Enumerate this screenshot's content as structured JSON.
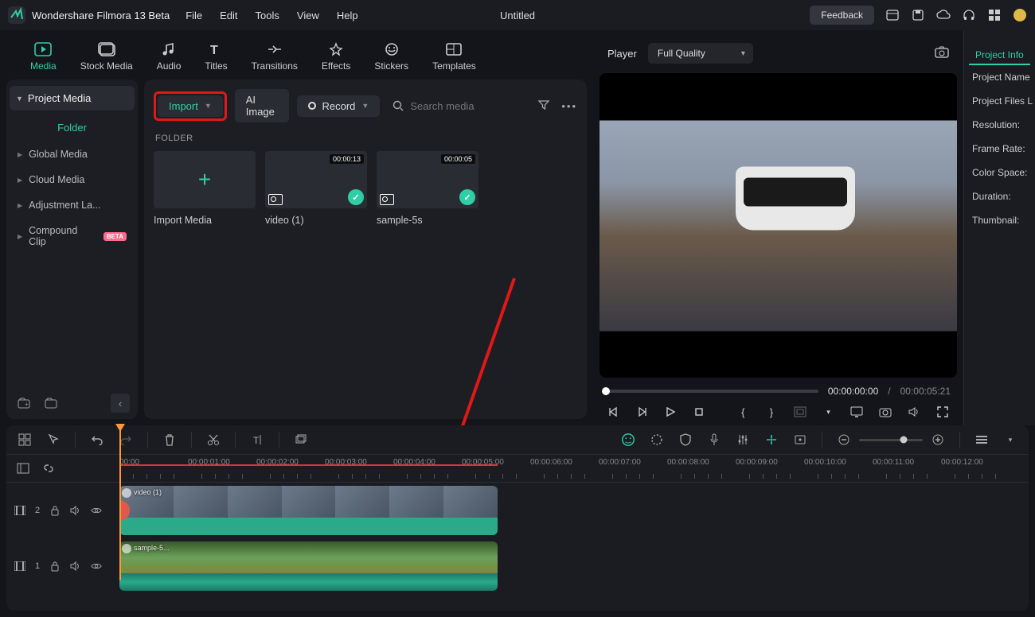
{
  "titlebar": {
    "appname": "Wondershare Filmora 13 Beta",
    "menu": [
      "File",
      "Edit",
      "Tools",
      "View",
      "Help"
    ],
    "project_title": "Untitled",
    "feedback": "Feedback"
  },
  "module_tabs": [
    {
      "label": "Media",
      "active": true
    },
    {
      "label": "Stock Media"
    },
    {
      "label": "Audio"
    },
    {
      "label": "Titles"
    },
    {
      "label": "Transitions"
    },
    {
      "label": "Effects"
    },
    {
      "label": "Stickers"
    },
    {
      "label": "Templates"
    }
  ],
  "sidebar": {
    "header": "Project Media",
    "folder_label": "Folder",
    "items": [
      {
        "label": "Global Media"
      },
      {
        "label": "Cloud Media"
      },
      {
        "label": "Adjustment La..."
      },
      {
        "label": "Compound Clip",
        "beta": true
      }
    ]
  },
  "content": {
    "import_btn": "Import",
    "ai_image_btn": "AI Image",
    "record_btn": "Record",
    "search_placeholder": "Search media",
    "folder_section": "FOLDER",
    "thumbs": [
      {
        "label": "Import Media",
        "type": "add"
      },
      {
        "label": "video (1)",
        "duration": "00:00:13",
        "scene": "vr"
      },
      {
        "label": "sample-5s",
        "duration": "00:00:05",
        "scene": "park"
      }
    ]
  },
  "preview": {
    "player_label": "Player",
    "quality": "Full Quality",
    "current_time": "00:00:00:00",
    "sep": "/",
    "total_time": "00:00:05:21"
  },
  "info_panel": {
    "tab": "Project Info",
    "fields": [
      "Project Name",
      "Project Files L",
      "Resolution:",
      "Frame Rate:",
      "Color Space:",
      "Duration:",
      "Thumbnail:"
    ]
  },
  "timeline": {
    "ruler": [
      "00:00",
      "00:00:01:00",
      "00:00:02:00",
      "00:00:03:00",
      "00:00:04:00",
      "00:00:05:00",
      "00:00:06:00",
      "00:00:07:00",
      "00:00:08:00",
      "00:00:09:00",
      "00:00:10:00",
      "00:00:11:00",
      "00:00:12:00"
    ],
    "tracks": [
      {
        "id": "2",
        "clip_label": "video (1)"
      },
      {
        "id": "1",
        "clip_label": "sample-5..."
      }
    ]
  }
}
